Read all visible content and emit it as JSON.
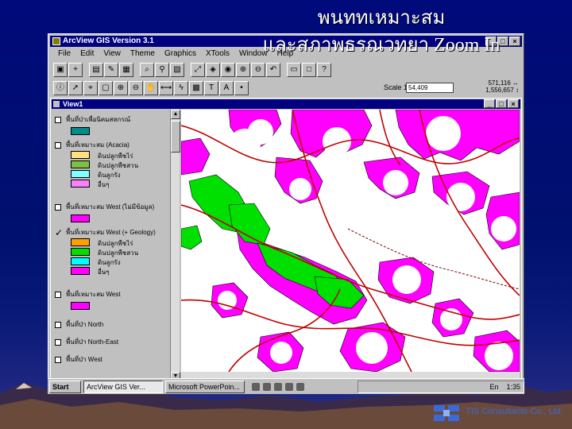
{
  "slide": {
    "title": "พนททเหมาะสม\nและสภาพธรณวทยา   Zoom In",
    "footer_company": "TIS Consultants Co., Ltd."
  },
  "app": {
    "window_title": "ArcView GIS Version 3.1",
    "menu": [
      "File",
      "Edit",
      "View",
      "Theme",
      "Graphics",
      "XTools",
      "Window",
      "Help"
    ],
    "scale_label": "Scale 1:",
    "scale_value": "54,409",
    "coord_x": "571,116 ↔",
    "coord_y": "1,556,657 ↕"
  },
  "view": {
    "title": "View1",
    "themes": {
      "t1": {
        "label": "พื้นที่ป่าเพื่อนิคมสหกรณ์",
        "checked": false
      },
      "t2": {
        "label": "พื้นที่เหมาะสม (Acacia)",
        "checked": false,
        "classes": [
          "ดินปลูกพืชไร่",
          "ดินปลูกพืชสวน",
          "ดินลูกรัง",
          "อื่นๆ"
        ]
      },
      "t3": {
        "label": "พื้นที่เหมาะสม West (ไม่มีข้อมูล)",
        "checked": false
      },
      "t4": {
        "label": "พื้นที่เหมาะสม West (+ Geology)",
        "checked": true,
        "classes": [
          "ดินปลูกพืชไร่",
          "ดินปลูกพืชสวน",
          "ดินลูกรัง",
          "อื่นๆ"
        ]
      },
      "t5": {
        "label": "พื้นที่เหมาะสม West",
        "checked": false
      },
      "t6": {
        "label": "พื้นที่ป่า North",
        "checked": false
      },
      "t7": {
        "label": "พื้นที่ป่า North-East",
        "checked": false
      },
      "t8": {
        "label": "พื้นที่ป่า West",
        "checked": false
      }
    }
  },
  "taskbar": {
    "start": "Start",
    "task1": "ArcView GIS Ver...",
    "task2": "Microsoft PowerPoin...",
    "lang": "En",
    "clock": "1:35"
  },
  "colors": {
    "suitable": "#ff00ff",
    "geology": "#00e000",
    "roads": "#c00000",
    "buffer_white": "#ffffff",
    "desktop_blue": "#000080"
  }
}
